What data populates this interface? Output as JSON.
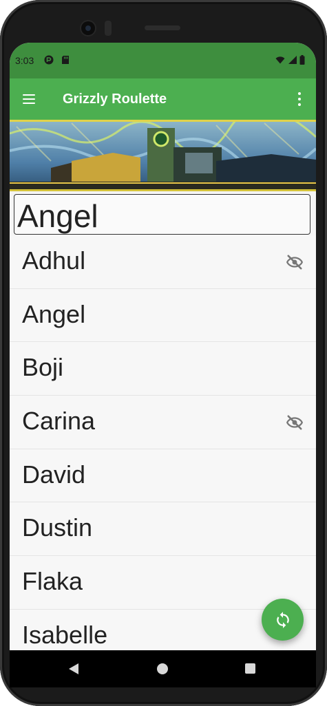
{
  "status_bar": {
    "time": "3:03",
    "notification_icons": [
      "app-notification-icon",
      "sd-card-icon"
    ],
    "system_icons": [
      "wifi-icon",
      "cellular-signal-icon",
      "battery-icon"
    ]
  },
  "app_bar": {
    "menu_icon": "hamburger-menu-icon",
    "title": "Grizzly Roulette",
    "overflow_icon": "more-vert-icon"
  },
  "search": {
    "value": "Angel"
  },
  "names": [
    {
      "label": "Adhul",
      "hidden": true
    },
    {
      "label": "Angel",
      "hidden": false
    },
    {
      "label": "Boji",
      "hidden": false
    },
    {
      "label": "Carina",
      "hidden": true
    },
    {
      "label": "David",
      "hidden": false
    },
    {
      "label": "Dustin",
      "hidden": false
    },
    {
      "label": "Flaka",
      "hidden": false
    },
    {
      "label": "Isabelle",
      "hidden": false
    }
  ],
  "fab": {
    "icon": "sync-icon"
  },
  "nav_bar": {
    "icons": [
      "back-icon",
      "home-icon",
      "recents-icon"
    ]
  },
  "colors": {
    "primary": "#4caf50",
    "status_bar": "#3e8e3e",
    "hidden_icon": "#777777"
  }
}
